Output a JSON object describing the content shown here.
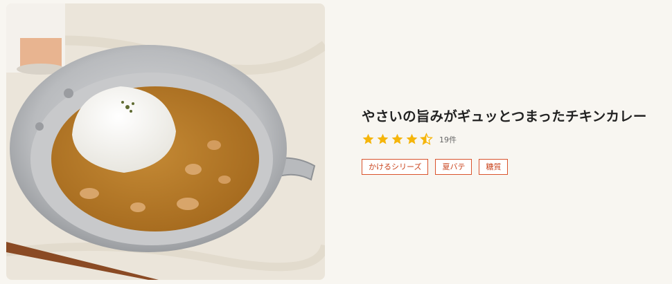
{
  "recipe": {
    "image_alt": "やさいの旨みがギュッとつまったチキンカレー",
    "title": "やさいの旨みがギュッとつまったチキンカレー",
    "rating": 4.5,
    "review_count": "19件",
    "star_color": "#f5b50a",
    "tags": [
      {
        "label": "かけるシリーズ"
      },
      {
        "label": "夏バテ"
      },
      {
        "label": "糖質"
      }
    ],
    "tag_color": "#d9522b"
  }
}
